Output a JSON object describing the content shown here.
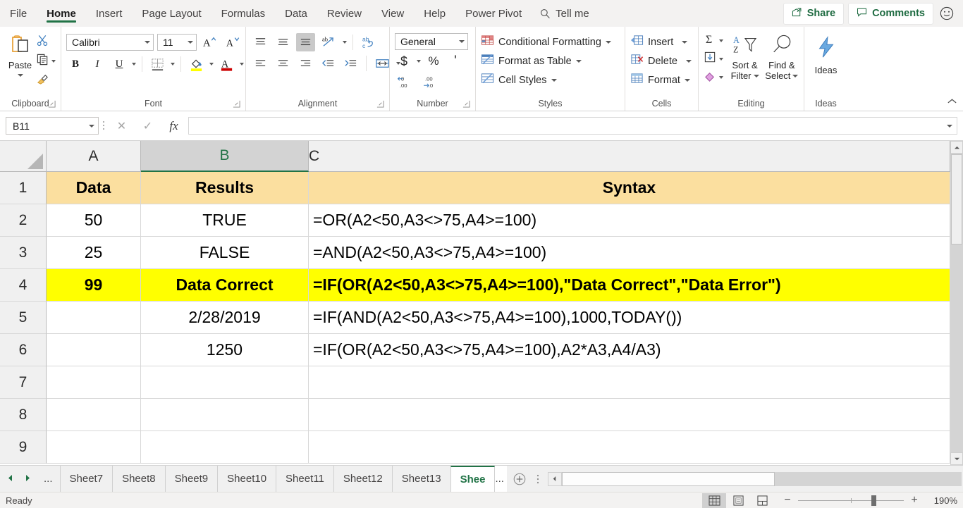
{
  "ribbon": {
    "tabs": [
      {
        "label": "File",
        "active": false
      },
      {
        "label": "Home",
        "active": true
      },
      {
        "label": "Insert",
        "active": false
      },
      {
        "label": "Page Layout",
        "active": false
      },
      {
        "label": "Formulas",
        "active": false
      },
      {
        "label": "Data",
        "active": false
      },
      {
        "label": "Review",
        "active": false
      },
      {
        "label": "View",
        "active": false
      },
      {
        "label": "Help",
        "active": false
      },
      {
        "label": "Power Pivot",
        "active": false
      }
    ],
    "tell_me": "Tell me",
    "share": "Share",
    "comments": "Comments",
    "groups": {
      "clipboard": {
        "label": "Clipboard",
        "paste": "Paste"
      },
      "font": {
        "label": "Font",
        "font_name": "Calibri",
        "font_size": "11",
        "bold": "B",
        "italic": "I",
        "underline": "U"
      },
      "alignment": {
        "label": "Alignment"
      },
      "number": {
        "label": "Number",
        "format": "General",
        "currency": "$",
        "percent": "%",
        "comma": "'"
      },
      "styles": {
        "label": "Styles",
        "conditional_formatting": "Conditional Formatting",
        "format_as_table": "Format as Table",
        "cell_styles": "Cell Styles"
      },
      "cells": {
        "label": "Cells",
        "insert": "Insert",
        "delete": "Delete",
        "format": "Format"
      },
      "editing": {
        "label": "Editing",
        "sort_filter_1": "Sort &",
        "sort_filter_2": "Filter",
        "find_select_1": "Find &",
        "find_select_2": "Select"
      },
      "ideas": {
        "label": "Ideas",
        "button": "Ideas"
      }
    }
  },
  "formula_bar": {
    "name_box": "B11",
    "cancel_icon": "✕",
    "enter_icon": "✓",
    "function_icon": "fx",
    "formula_value": ""
  },
  "grid": {
    "columns": [
      {
        "label": "A",
        "selected": false
      },
      {
        "label": "B",
        "selected": true
      },
      {
        "label": "C",
        "selected": false
      }
    ],
    "rows": [
      {
        "num": "1",
        "a": "Data",
        "b": "Results",
        "c": "Syntax",
        "style": "hdr"
      },
      {
        "num": "2",
        "a": "50",
        "b": "TRUE",
        "c": "=OR(A2<50,A3<>75,A4>=100)",
        "style": "normal"
      },
      {
        "num": "3",
        "a": "25",
        "b": "FALSE",
        "c": "=AND(A2<50,A3<>75,A4>=100)",
        "style": "normal"
      },
      {
        "num": "4",
        "a": "99",
        "b": "Data Correct",
        "c": "=IF(OR(A2<50,A3<>75,A4>=100),\"Data Correct\",\"Data Error\")",
        "style": "hl"
      },
      {
        "num": "5",
        "a": "",
        "b": "2/28/2019",
        "c": "=IF(AND(A2<50,A3<>75,A4>=100),1000,TODAY())",
        "style": "normal"
      },
      {
        "num": "6",
        "a": "",
        "b": "1250",
        "c": "=IF(OR(A2<50,A3<>75,A4>=100),A2*A3,A4/A3)",
        "style": "normal"
      },
      {
        "num": "7",
        "a": "",
        "b": "",
        "c": "",
        "style": "normal"
      },
      {
        "num": "8",
        "a": "",
        "b": "",
        "c": "",
        "style": "normal"
      },
      {
        "num": "9",
        "a": "",
        "b": "",
        "c": "",
        "style": "normal"
      }
    ]
  },
  "sheet_tabs": {
    "overflow": "...",
    "tabs": [
      {
        "label": "Sheet7",
        "active": false
      },
      {
        "label": "Sheet8",
        "active": false
      },
      {
        "label": "Sheet9",
        "active": false
      },
      {
        "label": "Sheet10",
        "active": false
      },
      {
        "label": "Sheet11",
        "active": false
      },
      {
        "label": "Sheet12",
        "active": false
      },
      {
        "label": "Sheet13",
        "active": false
      },
      {
        "label": "Shee",
        "active": true
      }
    ],
    "truncated_marker": "...",
    "add_sheet": "+"
  },
  "status_bar": {
    "state": "Ready",
    "zoom": "190%"
  },
  "colors": {
    "accent_green": "#217346",
    "header_fill": "#fbdf9f",
    "highlight_yellow": "#ffff00"
  }
}
